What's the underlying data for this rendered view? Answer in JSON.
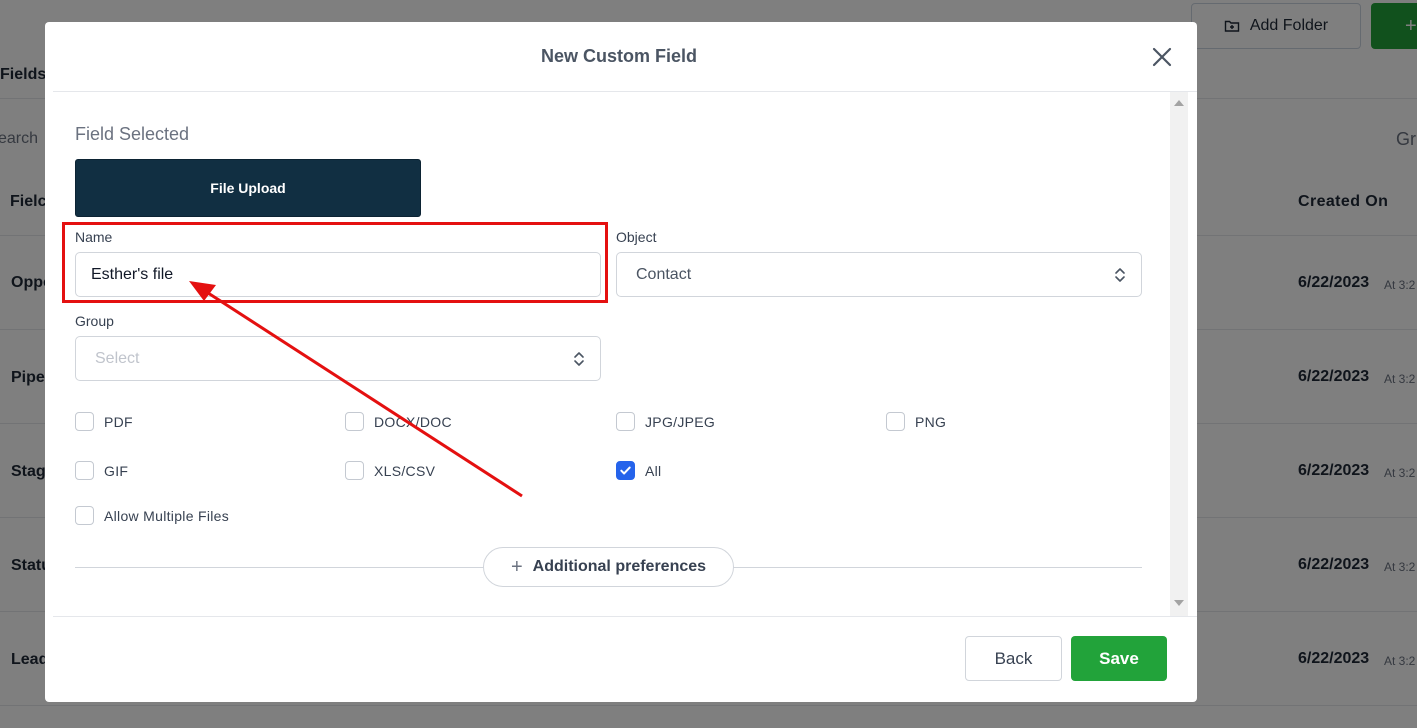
{
  "background": {
    "add_folder_label": "Add Folder",
    "green_button_label": "+",
    "tab_label": "Fields",
    "search_placeholder": "earch",
    "group_partial": "Gr",
    "column_field": "Fielc",
    "column_created_on": "Created On",
    "rows": [
      {
        "name": "Oppo",
        "date": "6/22/2023",
        "time": "At 3:2"
      },
      {
        "name": "Pipe",
        "date": "6/22/2023",
        "time": "At 3:2"
      },
      {
        "name": "Stag",
        "date": "6/22/2023",
        "time": "At 3:2"
      },
      {
        "name": "Statu",
        "date": "6/22/2023",
        "time": "At 3:2"
      },
      {
        "name": "Lead",
        "date": "6/22/2023",
        "time": "At 3:2"
      }
    ]
  },
  "modal": {
    "title": "New Custom Field",
    "section_title": "Field Selected",
    "field_type": "File Upload",
    "name": {
      "label": "Name",
      "value": "Esther's file"
    },
    "object": {
      "label": "Object",
      "value": "Contact"
    },
    "group": {
      "label": "Group",
      "placeholder": "Select"
    },
    "file_types": [
      {
        "label": "PDF",
        "checked": false
      },
      {
        "label": "DOCX/DOC",
        "checked": false
      },
      {
        "label": "JPG/JPEG",
        "checked": false
      },
      {
        "label": "PNG",
        "checked": false
      },
      {
        "label": "GIF",
        "checked": false
      },
      {
        "label": "XLS/CSV",
        "checked": false
      },
      {
        "label": "All",
        "checked": true
      }
    ],
    "allow_multiple": {
      "label": "Allow Multiple Files",
      "checked": false
    },
    "additional_preferences": "Additional preferences",
    "back_label": "Back",
    "save_label": "Save"
  },
  "colors": {
    "primary_dark": "#112f42",
    "save_green": "#22a33a",
    "checkbox_blue": "#2563eb",
    "annotation_red": "#e41010"
  }
}
